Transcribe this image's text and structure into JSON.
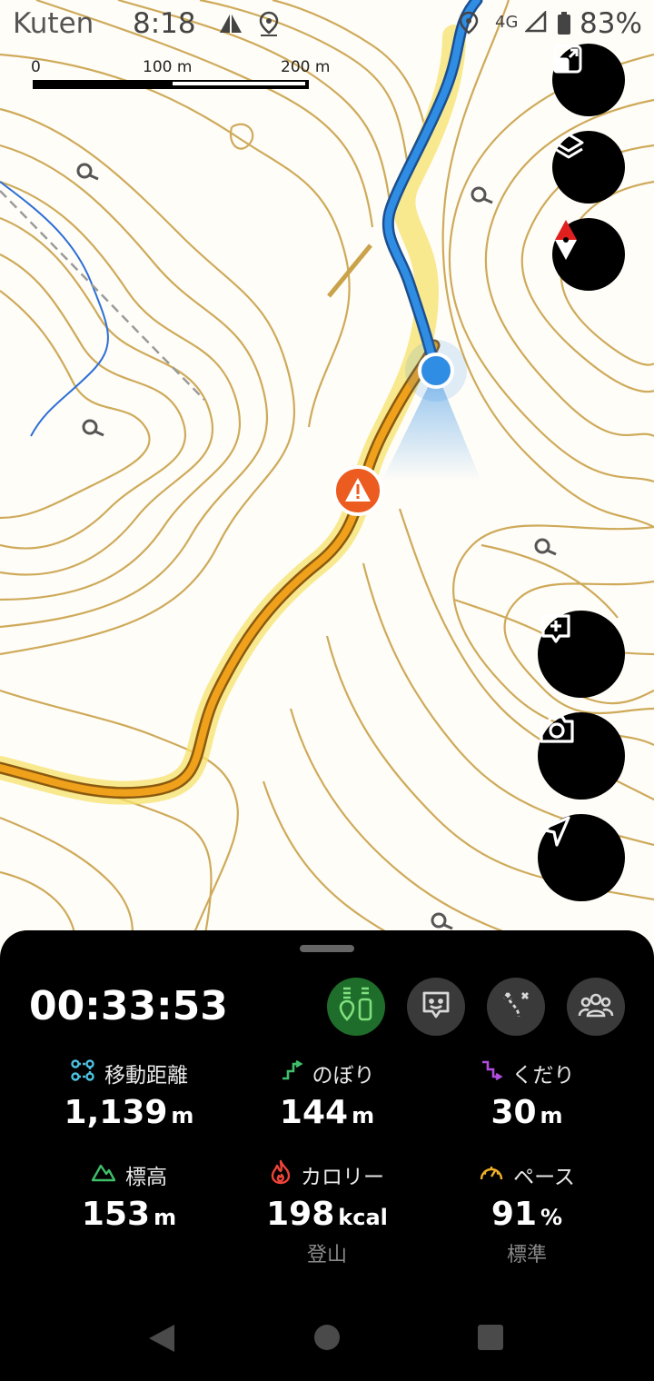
{
  "status_bar": {
    "carrier": "Kuten",
    "time": "8:18",
    "network": "4G",
    "battery": "83%"
  },
  "map": {
    "scale_labels": [
      "0",
      "100 m",
      "200 m"
    ],
    "colors": {
      "contour": "#c9a24a",
      "trail": "#f0a11c",
      "route": "#2f8de4",
      "highlight": "#f7e26b",
      "warning": "#ec5b1f",
      "location": "#2f8de4"
    }
  },
  "map_buttons": [
    {
      "name": "fit-screen-button",
      "icon": "fit-screen-icon"
    },
    {
      "name": "layers-button",
      "icon": "layers-icon"
    },
    {
      "name": "compass-button",
      "icon": "compass-icon"
    },
    {
      "name": "add-memo-button",
      "icon": "add-comment-icon"
    },
    {
      "name": "camera-button",
      "icon": "camera-icon"
    },
    {
      "name": "navigation-button",
      "icon": "navigation-arrow-icon"
    }
  ],
  "sheet": {
    "elapsed_time": "00:33:53",
    "controls": [
      "tracking-icon",
      "face-memo-icon",
      "route-off-icon",
      "group-icon"
    ],
    "stats": {
      "distance": {
        "label": "移動距離",
        "value": "1,139",
        "unit": "m"
      },
      "ascent": {
        "label": "のぼり",
        "value": "144",
        "unit": "m"
      },
      "descent": {
        "label": "くだり",
        "value": "30",
        "unit": "m"
      },
      "altitude": {
        "label": "標高",
        "value": "153",
        "unit": "m"
      },
      "calories": {
        "label": "カロリー",
        "value": "198",
        "unit": "kcal",
        "sub": "登山"
      },
      "pace": {
        "label": "ペース",
        "value": "91",
        "unit": "%",
        "sub": "標準"
      }
    }
  }
}
